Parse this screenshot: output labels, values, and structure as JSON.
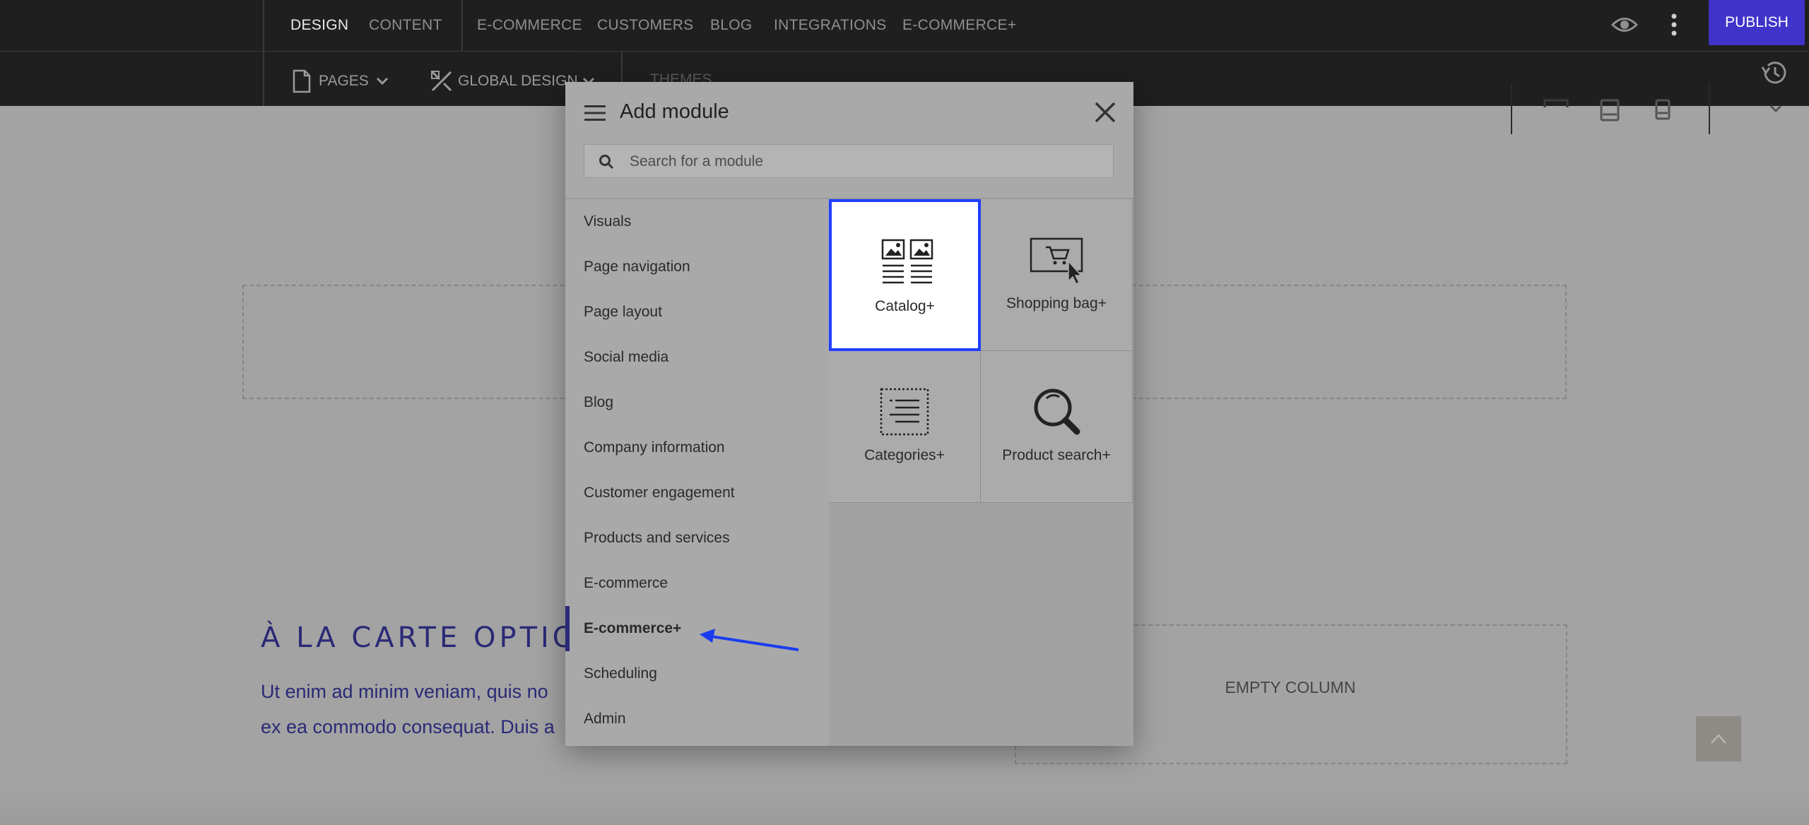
{
  "topbar": {
    "tabs_left": [
      {
        "label": "DESIGN",
        "active": true
      },
      {
        "label": "CONTENT",
        "active": false
      }
    ],
    "tabs_main": [
      {
        "label": "E-COMMERCE"
      },
      {
        "label": "CUSTOMERS"
      },
      {
        "label": "BLOG"
      },
      {
        "label": "INTEGRATIONS"
      },
      {
        "label": "E-COMMERCE+"
      }
    ],
    "publish_label": "PUBLISH",
    "pages_label": "PAGES",
    "global_design_label": "GLOBAL DESIGN",
    "themes_label": "THEMES"
  },
  "page": {
    "section_heading": "À LA CARTE OPTIONS",
    "body_line1": "Ut enim ad minim veniam, quis no",
    "body_line2": "ex ea commodo consequat. Duis a",
    "empty_column_label": "EMPTY COLUMN"
  },
  "modal": {
    "title": "Add module",
    "search_placeholder": "Search for a module",
    "categories": [
      {
        "label": "Visuals",
        "active": false
      },
      {
        "label": "Page navigation",
        "active": false
      },
      {
        "label": "Page layout",
        "active": false
      },
      {
        "label": "Social media",
        "active": false
      },
      {
        "label": "Blog",
        "active": false
      },
      {
        "label": "Company information",
        "active": false
      },
      {
        "label": "Customer engagement",
        "active": false
      },
      {
        "label": "Products and services",
        "active": false
      },
      {
        "label": "E-commerce",
        "active": false
      },
      {
        "label": "E-commerce+",
        "active": true
      },
      {
        "label": "Scheduling",
        "active": false
      },
      {
        "label": "Admin",
        "active": false
      }
    ],
    "modules": [
      {
        "label": "Catalog+",
        "icon": "catalog-icon",
        "selected": true
      },
      {
        "label": "Shopping bag+",
        "icon": "shopping-bag-icon",
        "selected": false
      },
      {
        "label": "Categories+",
        "icon": "categories-icon",
        "selected": false
      },
      {
        "label": "Product search+",
        "icon": "product-search-icon",
        "selected": false
      }
    ]
  },
  "colors": {
    "publish": "#3f33c9",
    "selection_border": "#1f3dff",
    "annotation_arrow": "#1a3cf0",
    "heading_text": "#2a2a77"
  }
}
